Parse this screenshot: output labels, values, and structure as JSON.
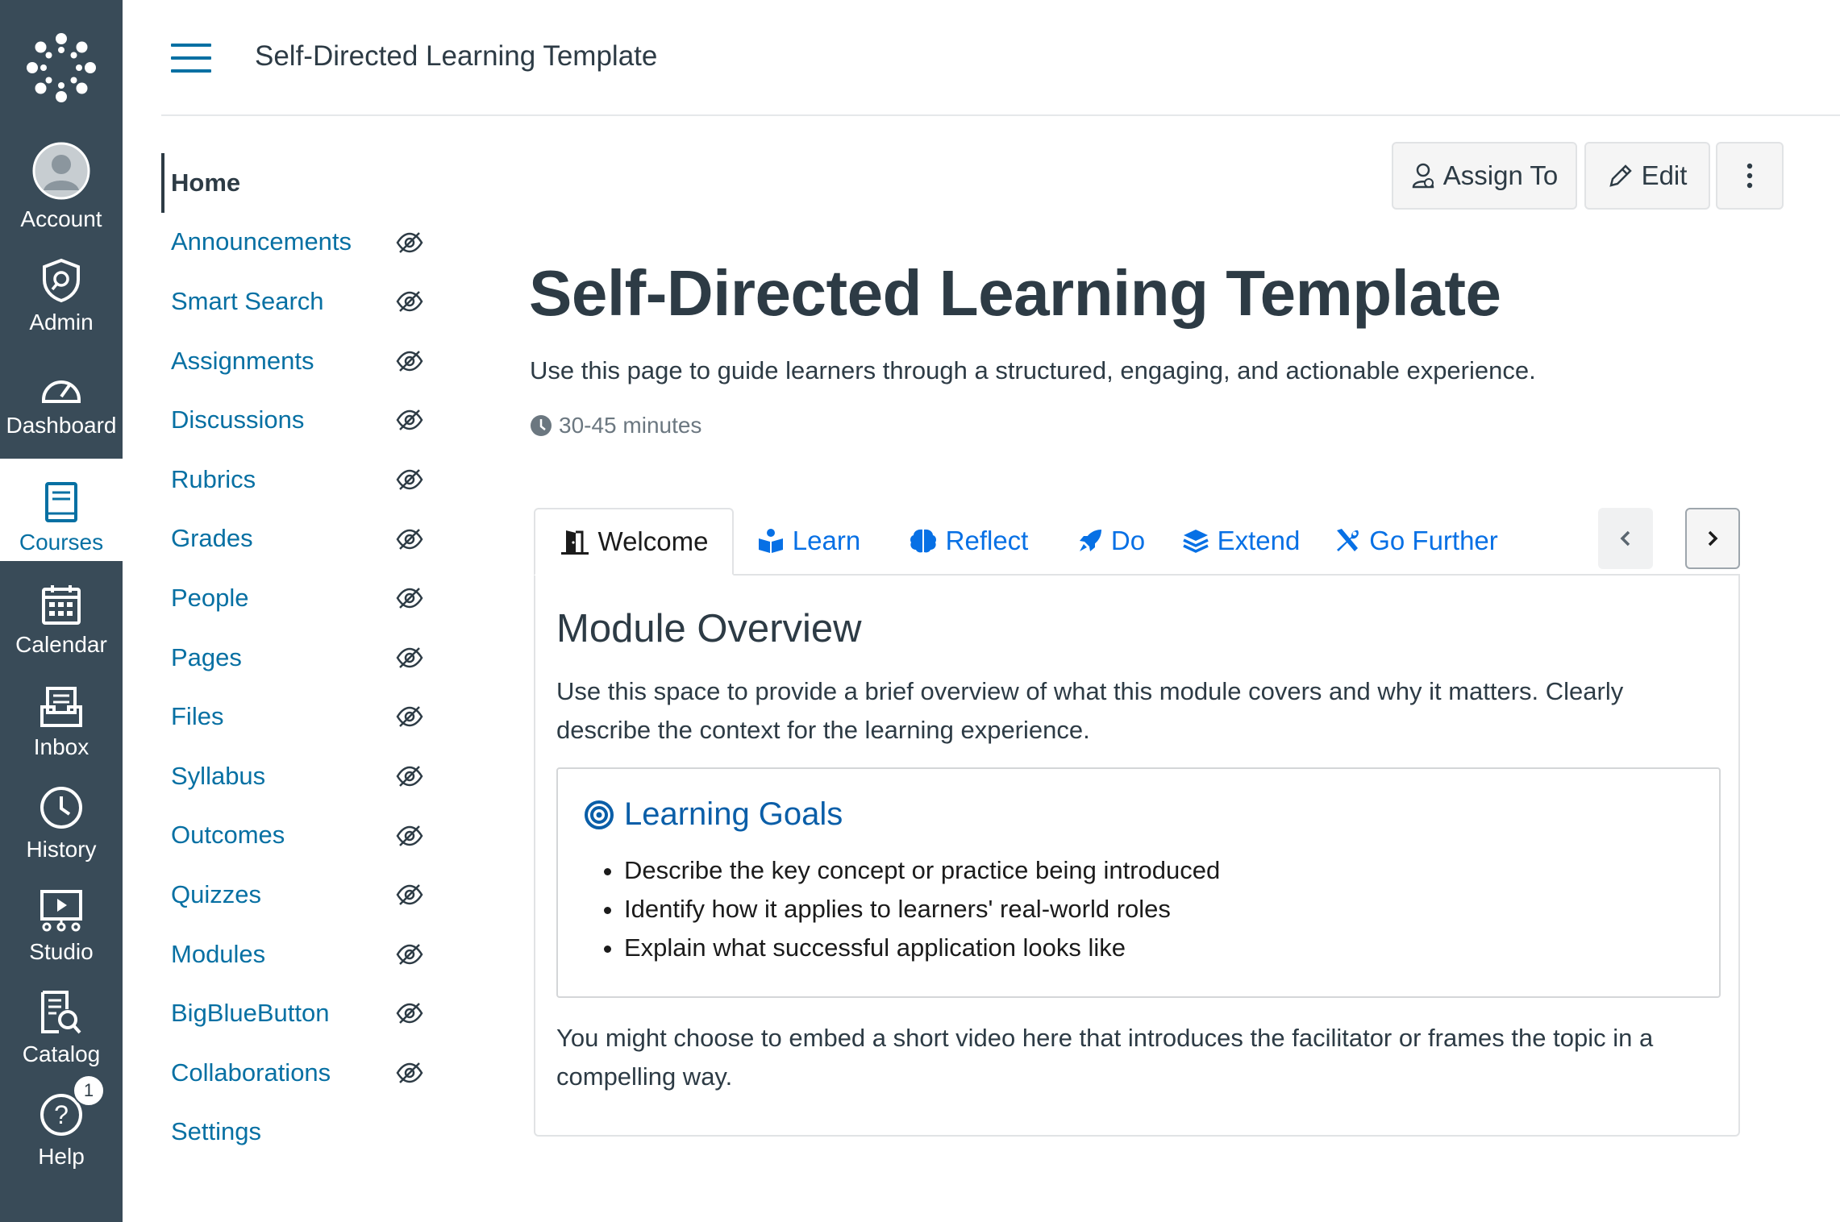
{
  "global_nav": {
    "items": [
      {
        "label": "Account",
        "icon": "account-avatar-icon"
      },
      {
        "label": "Admin",
        "icon": "admin-shield-icon"
      },
      {
        "label": "Dashboard",
        "icon": "dashboard-gauge-icon"
      },
      {
        "label": "Courses",
        "icon": "courses-book-icon",
        "active": true
      },
      {
        "label": "Calendar",
        "icon": "calendar-icon"
      },
      {
        "label": "Inbox",
        "icon": "inbox-icon"
      },
      {
        "label": "History",
        "icon": "history-clock-icon"
      },
      {
        "label": "Studio",
        "icon": "studio-icon"
      },
      {
        "label": "Catalog",
        "icon": "catalog-icon"
      },
      {
        "label": "Help",
        "icon": "help-icon",
        "badge": "1"
      }
    ]
  },
  "header": {
    "breadcrumb": "Self-Directed Learning Template"
  },
  "course_nav": {
    "items": [
      {
        "label": "Home",
        "active": true,
        "hidden": false
      },
      {
        "label": "Announcements",
        "hidden": true
      },
      {
        "label": "Smart Search",
        "hidden": true
      },
      {
        "label": "Assignments",
        "hidden": true
      },
      {
        "label": "Discussions",
        "hidden": true
      },
      {
        "label": "Rubrics",
        "hidden": true
      },
      {
        "label": "Grades",
        "hidden": true
      },
      {
        "label": "People",
        "hidden": true
      },
      {
        "label": "Pages",
        "hidden": true
      },
      {
        "label": "Files",
        "hidden": true
      },
      {
        "label": "Syllabus",
        "hidden": true
      },
      {
        "label": "Outcomes",
        "hidden": true
      },
      {
        "label": "Quizzes",
        "hidden": true
      },
      {
        "label": "Modules",
        "hidden": true
      },
      {
        "label": "BigBlueButton",
        "hidden": true
      },
      {
        "label": "Collaborations",
        "hidden": true
      },
      {
        "label": "Settings",
        "hidden": false
      }
    ]
  },
  "toolbar": {
    "assign_label": "Assign To",
    "edit_label": "Edit"
  },
  "page": {
    "title": "Self-Directed Learning Template",
    "subtitle": "Use this page to guide learners through a structured, engaging, and actionable experience.",
    "duration": "30-45 minutes"
  },
  "tabs": [
    {
      "label": "Welcome",
      "icon": "door-open-icon",
      "active": true
    },
    {
      "label": "Learn",
      "icon": "book-reader-icon"
    },
    {
      "label": "Reflect",
      "icon": "brain-icon"
    },
    {
      "label": "Do",
      "icon": "rocket-icon"
    },
    {
      "label": "Extend",
      "icon": "layers-icon"
    },
    {
      "label": "Go Further",
      "icon": "tools-icon"
    }
  ],
  "panel": {
    "heading": "Module Overview",
    "intro": "Use this space to provide a brief overview of what this module covers and why it matters. Clearly describe the context for the learning experience.",
    "goals_heading": "Learning Goals",
    "goals": [
      "Describe the key concept or practice being introduced",
      "Identify how it applies to learners' real-world roles",
      "Explain what successful application looks like"
    ],
    "outro": "You might choose to embed a short video here that introduces the facilitator or frames the topic in a compelling way."
  },
  "colors": {
    "nav_bg": "#394b58",
    "link": "#0770a3",
    "tab_link": "#0770e5",
    "goals_heading": "#0a5ea8"
  }
}
